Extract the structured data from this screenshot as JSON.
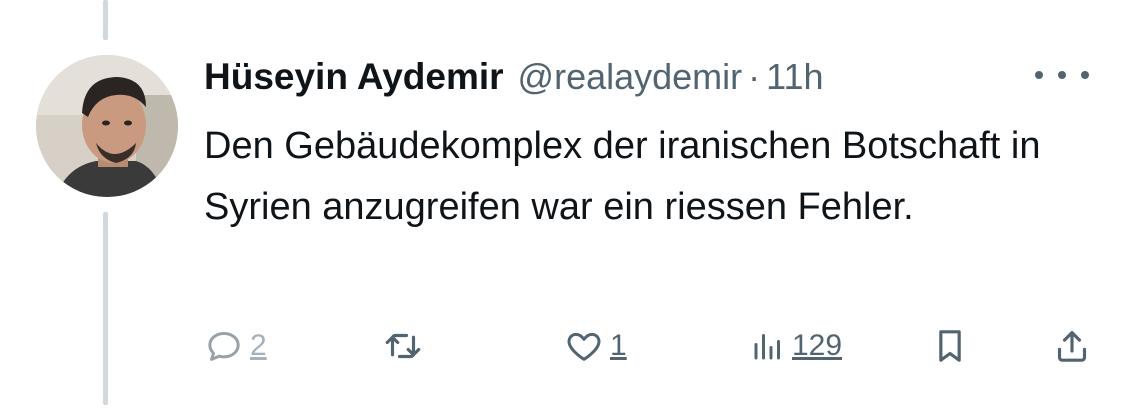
{
  "tweet": {
    "author_name": "Hüseyin Aydemir",
    "handle": "@realaydemir",
    "separator": "·",
    "time_ago": "11h",
    "text": "Den Gebäudekomplex der iranischen Botschaft in Syrien anzugreifen war ein riessen Fehler."
  },
  "actions": {
    "reply_count": "2",
    "like_count": "1",
    "views_count": "129"
  },
  "icons": {
    "more": "more-horizontal-icon",
    "reply": "reply-bubble-icon",
    "retweet": "retweet-icon",
    "like": "heart-icon",
    "views": "bar-chart-icon",
    "bookmark": "bookmark-icon",
    "share": "share-upload-icon"
  },
  "colors": {
    "text_primary": "#0f1419",
    "text_secondary": "#536471",
    "thread_line": "#cfd9de"
  }
}
